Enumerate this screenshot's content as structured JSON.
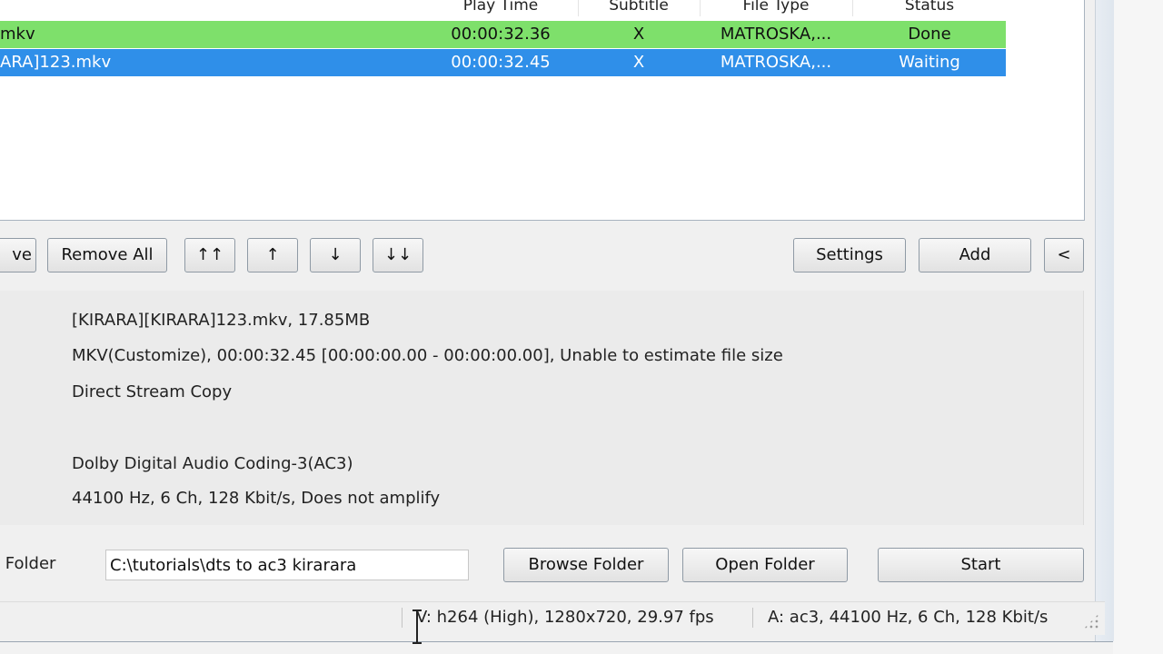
{
  "list": {
    "columns": [
      "Play Time",
      "Subtitle",
      "File Type",
      "Status"
    ],
    "rows": [
      {
        "name": "mkv",
        "play_time": "00:00:32.36",
        "subtitle": "X",
        "file_type": "MATROSKA,...",
        "status": "Done"
      },
      {
        "name": "ARA]123.mkv",
        "play_time": "00:00:32.45",
        "subtitle": "X",
        "file_type": "MATROSKA,...",
        "status": "Waiting"
      }
    ]
  },
  "buttons": {
    "remove": "ve",
    "remove_all": "Remove All",
    "move_top": "↑↑",
    "move_up": "↑",
    "move_down": "↓",
    "move_bottom": "↓↓",
    "settings": "Settings",
    "add": "Add",
    "collapse": "<"
  },
  "info": {
    "file": "[KIRARA][KIRARA]123.mkv, 17.85MB",
    "format": "MKV(Customize), 00:00:32.45 [00:00:00.00 - 00:00:00.00], Unable to estimate file size",
    "video": "Direct Stream Copy",
    "audio_codec": "Dolby Digital Audio Coding-3(AC3)",
    "audio_params": "44100 Hz, 6 Ch, 128 Kbit/s, Does not amplify"
  },
  "output": {
    "label": ": Folder",
    "path": "C:\\tutorials\\dts to ac3 kirarara",
    "browse_label": "Browse Folder",
    "open_label": "Open Folder",
    "start_label": "Start"
  },
  "status": {
    "video": "V: h264 (High), 1280x720, 29.97 fps",
    "audio": "A: ac3, 44100 Hz, 6 Ch, 128 Kbit/s"
  },
  "colors": {
    "done_row": "#7ee06b",
    "selected_row": "#2f8fe9"
  }
}
